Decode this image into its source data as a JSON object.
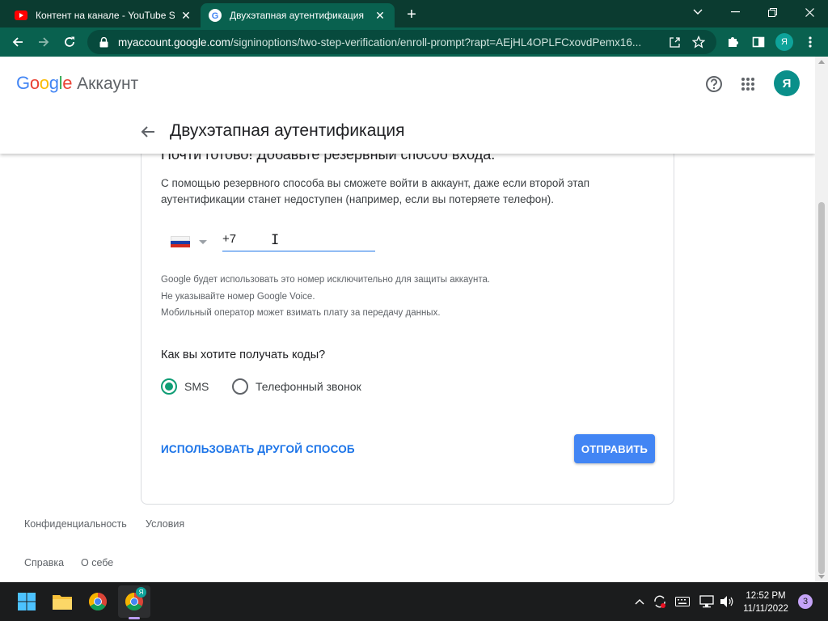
{
  "browser": {
    "tabs": [
      {
        "title": "Контент на канале - YouTube Studio",
        "favicon": "youtube-icon",
        "active": false
      },
      {
        "title": "Двухэтапная аутентификация",
        "favicon": "google-icon",
        "active": true
      }
    ],
    "url_host": "myaccount.google.com",
    "url_path": "/signinoptions/two-step-verification/enroll-prompt?rapt=AEjHL4OPLFCxovdPemx16...",
    "profile_initial": "Я"
  },
  "header": {
    "logo_google": "Google",
    "logo_account": "Аккаунт",
    "avatar_initial": "Я",
    "page_title": "Двухэтапная аутентификация"
  },
  "card": {
    "heading": "Почти готово! Добавьте резервный способ входа.",
    "description": "С помощью резервного способа вы сможете войти в аккаунт, даже если второй этап аутентификации станет недоступен (например, если вы потеряете телефон).",
    "country": "Russia",
    "phone_value": "+7",
    "hint_1": "Google будет использовать это номер исключительно для защиты аккаунта.",
    "hint_2": "Не указывайте номер Google Voice.",
    "hint_3": "Мобильный оператор может взимать плату за передачу данных.",
    "question": "Как вы хотите получать коды?",
    "option_sms": "SMS",
    "option_call": "Телефонный звонок",
    "selected_option": "SMS",
    "alt_method": "ИСПОЛЬЗОВАТЬ ДРУГОЙ СПОСОБ",
    "send": "ОТПРАВИТЬ"
  },
  "footer": {
    "privacy": "Конфиденциальность",
    "terms": "Условия",
    "help": "Справка",
    "about": "О себе"
  },
  "taskbar": {
    "time": "12:52 PM",
    "date": "11/11/2022",
    "notifications": "3",
    "chrome_badge": "Я"
  },
  "colors": {
    "tab_strip": "#0b3b30",
    "toolbar": "#09614f",
    "accent_blue": "#1a73e8",
    "button_blue": "#4285f4",
    "radio_green": "#0f9d75",
    "avatar": "#0a8f8a"
  }
}
